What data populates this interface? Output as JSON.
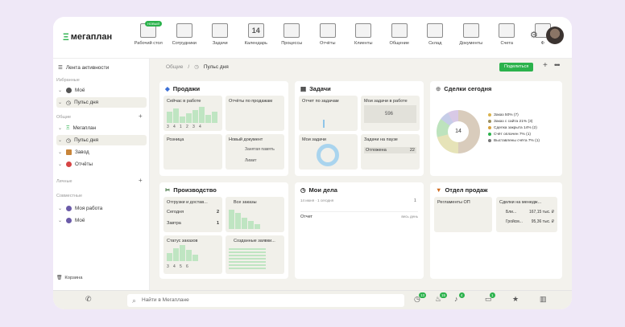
{
  "app": {
    "logo": "мегаплан",
    "accent": "#2bb24c"
  },
  "nav": [
    {
      "label": "Рабочий стол",
      "icon": "desktop-icon",
      "badge": "НОВЫЙ"
    },
    {
      "label": "Сотрудники",
      "icon": "employees-icon"
    },
    {
      "label": "Задачи",
      "icon": "tasks-icon"
    },
    {
      "label": "Календарь",
      "icon": "calendar-icon",
      "day": "14"
    },
    {
      "label": "Процессы",
      "icon": "processes-icon"
    },
    {
      "label": "Отчёты",
      "icon": "reports-icon"
    },
    {
      "label": "Клиенты",
      "icon": "clients-icon"
    },
    {
      "label": "Общение",
      "icon": "chat-icon"
    },
    {
      "label": "Склад",
      "icon": "warehouse-icon"
    },
    {
      "label": "Документы",
      "icon": "documents-icon"
    },
    {
      "label": "Счета",
      "icon": "invoices-icon"
    },
    {
      "label": "Ф",
      "icon": "more-icon"
    }
  ],
  "sidebar": {
    "feed": "Лента активности",
    "sections": {
      "favorites": "Избранные",
      "common": "Общие",
      "personal": "Личные",
      "shared": "Совместные"
    },
    "favorites": [
      "Моё",
      "Пульс дня"
    ],
    "common": [
      "Мегаплан",
      "Пульс дня",
      "Завод",
      "Отчёты"
    ],
    "shared": [
      "Моя работа",
      "Моё"
    ],
    "trash": "Корзина"
  },
  "breadcrumb": {
    "parent": "Общие",
    "sep": "/",
    "current": "Пульс дня"
  },
  "actions": {
    "share": "Поделиться"
  },
  "cards": {
    "sales": {
      "title": "Продажи",
      "now_working": "Сейчас в работе",
      "now_nums": [
        "3",
        "4",
        "1",
        "2",
        "3",
        "4"
      ],
      "reports": "Отчёты по продажам",
      "retail": "Розница",
      "new_doc": "Новый документ",
      "new_doc_sub": "Занятая память",
      "new_doc_sub2": "Лимит"
    },
    "tasks": {
      "title": "Задачи",
      "report": "Отчет по задачам",
      "my_work": "Мои задачи в работе",
      "my_work_value": "596",
      "mine": "Мои задачи",
      "paused": "Задачи на паузе",
      "postponed": "Отложена",
      "postponed_value": "22"
    },
    "deals": {
      "title": "Сделки сегодня",
      "total": "14",
      "legend": [
        "Заказ 50% (7)",
        "Заказ с сайта 21% (3)",
        "Сделка закрыта 14% (2)",
        "Счёт оплачен 7% (1)",
        "Выставлены счёта 7% (1)"
      ]
    },
    "production": {
      "title": "Производство",
      "shipments": "Отгрузки и достав...",
      "today": "Сегодня",
      "today_value": "2",
      "tomorrow": "Завтра",
      "tomorrow_value": "1",
      "all_orders": "Все заказы",
      "order_status": "Статус заказов",
      "status_nums": [
        "3",
        "4",
        "5",
        "6"
      ],
      "created": "Созданные заявки..."
    },
    "my_affairs": {
      "title": "Мои дела",
      "date": "14 июня · 1 сегодня",
      "count": "1",
      "row": "Отчет",
      "row_right": "весь день"
    },
    "sales_dept": {
      "title": "Отдел продаж",
      "regulations": "Регламенты ОП",
      "manager_deals": "Сделки на менедж...",
      "m1": "Бли...",
      "m1_value": "167,15 тыс. ₽",
      "m2": "Гройсм...",
      "m2_value": "95,36 тыс. ₽"
    }
  },
  "bottombar": {
    "search_placeholder": "Найти в Мегаплане",
    "badges": [
      "13",
      "15",
      "4",
      "1"
    ]
  }
}
